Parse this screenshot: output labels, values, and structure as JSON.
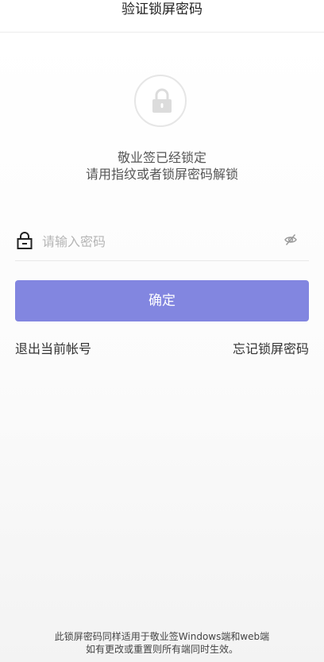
{
  "header": {
    "title": "验证锁屏密码"
  },
  "lock_screen": {
    "icon": "lock-icon",
    "message_line1": "敬业签已经锁定",
    "message_line2": "请用指纹或者锁屏密码解锁"
  },
  "password_field": {
    "icon": "padlock-icon",
    "placeholder": "请输入密码",
    "value": "",
    "toggle_icon": "eye-hidden-icon"
  },
  "confirm_button": {
    "label": "确定",
    "color": "#8286e0"
  },
  "links": {
    "logout": "退出当前帐号",
    "forgot": "忘记锁屏密码"
  },
  "footer": {
    "line1": "此锁屏密码同样适用于敬业签Windows端和web端",
    "line2": "如有更改或重置则所有端同时生效。"
  }
}
